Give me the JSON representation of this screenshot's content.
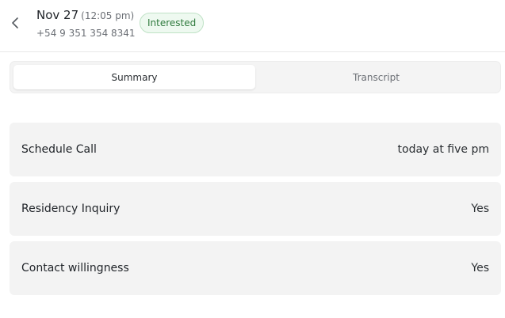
{
  "header": {
    "date": "Nov 27",
    "time": "(12:05 pm)",
    "phone": "+54 9 351 354 8341",
    "status": "Interested"
  },
  "tabs": [
    {
      "label": "Summary",
      "active": true
    },
    {
      "label": "Transcript",
      "active": false
    }
  ],
  "fields": [
    {
      "label": "Schedule Call",
      "value": "today at five pm"
    },
    {
      "label": "Residency Inquiry",
      "value": "Yes"
    },
    {
      "label": "Contact willingness",
      "value": "Yes"
    }
  ],
  "colors": {
    "status_text": "#2f7a3d",
    "status_bg": "#eef9f0",
    "status_border": "#bfe2c6",
    "row_bg": "#f3f3f3"
  },
  "icons": {
    "back": "chevron-left-icon"
  }
}
